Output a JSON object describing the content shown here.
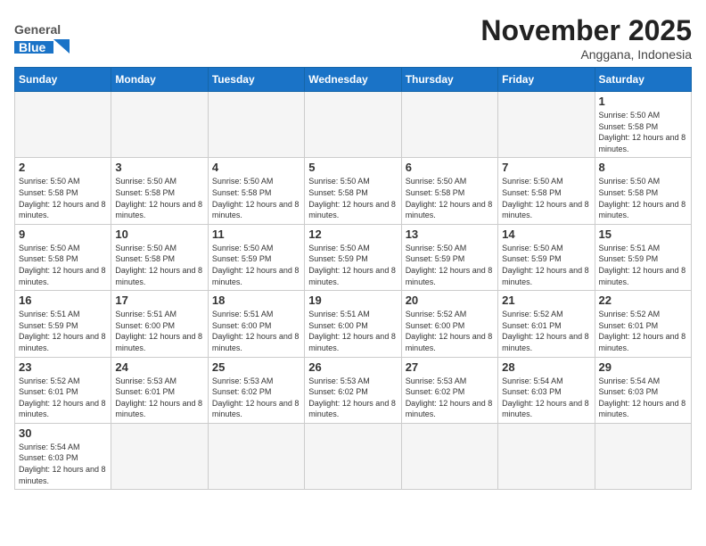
{
  "header": {
    "logo_general": "General",
    "logo_blue": "Blue",
    "month_title": "November 2025",
    "subtitle": "Anggana, Indonesia"
  },
  "weekdays": [
    "Sunday",
    "Monday",
    "Tuesday",
    "Wednesday",
    "Thursday",
    "Friday",
    "Saturday"
  ],
  "weeks": [
    [
      {
        "day": "",
        "info": ""
      },
      {
        "day": "",
        "info": ""
      },
      {
        "day": "",
        "info": ""
      },
      {
        "day": "",
        "info": ""
      },
      {
        "day": "",
        "info": ""
      },
      {
        "day": "",
        "info": ""
      },
      {
        "day": "1",
        "info": "Sunrise: 5:50 AM\nSunset: 5:58 PM\nDaylight: 12 hours and 8 minutes."
      }
    ],
    [
      {
        "day": "2",
        "info": "Sunrise: 5:50 AM\nSunset: 5:58 PM\nDaylight: 12 hours and 8 minutes."
      },
      {
        "day": "3",
        "info": "Sunrise: 5:50 AM\nSunset: 5:58 PM\nDaylight: 12 hours and 8 minutes."
      },
      {
        "day": "4",
        "info": "Sunrise: 5:50 AM\nSunset: 5:58 PM\nDaylight: 12 hours and 8 minutes."
      },
      {
        "day": "5",
        "info": "Sunrise: 5:50 AM\nSunset: 5:58 PM\nDaylight: 12 hours and 8 minutes."
      },
      {
        "day": "6",
        "info": "Sunrise: 5:50 AM\nSunset: 5:58 PM\nDaylight: 12 hours and 8 minutes."
      },
      {
        "day": "7",
        "info": "Sunrise: 5:50 AM\nSunset: 5:58 PM\nDaylight: 12 hours and 8 minutes."
      },
      {
        "day": "8",
        "info": "Sunrise: 5:50 AM\nSunset: 5:58 PM\nDaylight: 12 hours and 8 minutes."
      }
    ],
    [
      {
        "day": "9",
        "info": "Sunrise: 5:50 AM\nSunset: 5:58 PM\nDaylight: 12 hours and 8 minutes."
      },
      {
        "day": "10",
        "info": "Sunrise: 5:50 AM\nSunset: 5:58 PM\nDaylight: 12 hours and 8 minutes."
      },
      {
        "day": "11",
        "info": "Sunrise: 5:50 AM\nSunset: 5:59 PM\nDaylight: 12 hours and 8 minutes."
      },
      {
        "day": "12",
        "info": "Sunrise: 5:50 AM\nSunset: 5:59 PM\nDaylight: 12 hours and 8 minutes."
      },
      {
        "day": "13",
        "info": "Sunrise: 5:50 AM\nSunset: 5:59 PM\nDaylight: 12 hours and 8 minutes."
      },
      {
        "day": "14",
        "info": "Sunrise: 5:50 AM\nSunset: 5:59 PM\nDaylight: 12 hours and 8 minutes."
      },
      {
        "day": "15",
        "info": "Sunrise: 5:51 AM\nSunset: 5:59 PM\nDaylight: 12 hours and 8 minutes."
      }
    ],
    [
      {
        "day": "16",
        "info": "Sunrise: 5:51 AM\nSunset: 5:59 PM\nDaylight: 12 hours and 8 minutes."
      },
      {
        "day": "17",
        "info": "Sunrise: 5:51 AM\nSunset: 6:00 PM\nDaylight: 12 hours and 8 minutes."
      },
      {
        "day": "18",
        "info": "Sunrise: 5:51 AM\nSunset: 6:00 PM\nDaylight: 12 hours and 8 minutes."
      },
      {
        "day": "19",
        "info": "Sunrise: 5:51 AM\nSunset: 6:00 PM\nDaylight: 12 hours and 8 minutes."
      },
      {
        "day": "20",
        "info": "Sunrise: 5:52 AM\nSunset: 6:00 PM\nDaylight: 12 hours and 8 minutes."
      },
      {
        "day": "21",
        "info": "Sunrise: 5:52 AM\nSunset: 6:01 PM\nDaylight: 12 hours and 8 minutes."
      },
      {
        "day": "22",
        "info": "Sunrise: 5:52 AM\nSunset: 6:01 PM\nDaylight: 12 hours and 8 minutes."
      }
    ],
    [
      {
        "day": "23",
        "info": "Sunrise: 5:52 AM\nSunset: 6:01 PM\nDaylight: 12 hours and 8 minutes."
      },
      {
        "day": "24",
        "info": "Sunrise: 5:53 AM\nSunset: 6:01 PM\nDaylight: 12 hours and 8 minutes."
      },
      {
        "day": "25",
        "info": "Sunrise: 5:53 AM\nSunset: 6:02 PM\nDaylight: 12 hours and 8 minutes."
      },
      {
        "day": "26",
        "info": "Sunrise: 5:53 AM\nSunset: 6:02 PM\nDaylight: 12 hours and 8 minutes."
      },
      {
        "day": "27",
        "info": "Sunrise: 5:53 AM\nSunset: 6:02 PM\nDaylight: 12 hours and 8 minutes."
      },
      {
        "day": "28",
        "info": "Sunrise: 5:54 AM\nSunset: 6:03 PM\nDaylight: 12 hours and 8 minutes."
      },
      {
        "day": "29",
        "info": "Sunrise: 5:54 AM\nSunset: 6:03 PM\nDaylight: 12 hours and 8 minutes."
      }
    ],
    [
      {
        "day": "30",
        "info": "Sunrise: 5:54 AM\nSunset: 6:03 PM\nDaylight: 12 hours and 8 minutes."
      },
      {
        "day": "",
        "info": ""
      },
      {
        "day": "",
        "info": ""
      },
      {
        "day": "",
        "info": ""
      },
      {
        "day": "",
        "info": ""
      },
      {
        "day": "",
        "info": ""
      },
      {
        "day": "",
        "info": ""
      }
    ]
  ]
}
